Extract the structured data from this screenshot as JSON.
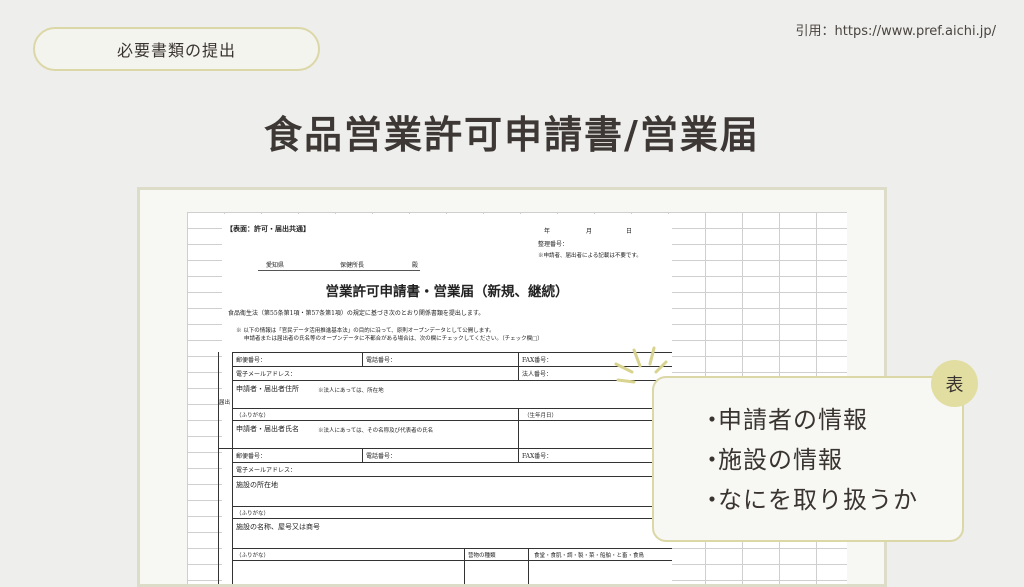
{
  "header": {
    "tag_label": "必要書類の提出",
    "source": "引用：https://www.pref.aichi.jp/"
  },
  "title": "食品営業許可申請書/営業届",
  "form": {
    "top_label": "【表面：許可・届出共通】",
    "date_year": "年",
    "date_month": "月",
    "date_day": "日",
    "ref_no": "整理番号：",
    "ref_note": "※申請者、届出者による記載は不要です。",
    "addressee_pref": "愛知県",
    "addressee_office": "保健所長",
    "addressee_honorific": "殿",
    "title": "営業許可申請書・営業届（新規、継続）",
    "intro": "食品衛生法（第55条第1項・第57条第1項）の規定に基づき次のとおり関係書類を提出します。",
    "note_line1": "※ 以下の情報は「官民データ活用推進基本法」の目的に沿って、原則オープンデータとして公開します。",
    "note_line2": "申請者または届出者の氏名等のオープンデータに不都合がある場合は、次の欄にチェックしてください。（チェック欄□）",
    "postal": "郵便番号：",
    "phone": "電話番号：",
    "fax": "FAX番号：",
    "email": "電子メールアドレス：",
    "corp_no": "法人番号：",
    "applicant_address": "申請者・届出者住所",
    "applicant_address_note": "※法人にあっては、所在地",
    "furigana": "（ふりがな）",
    "birthdate": "（生年月日）",
    "applicant_name": "申請者・届出者氏名",
    "applicant_name_note": "※法人にあっては、その名称及び代表者の氏名",
    "side_label": "届出",
    "postal2": "郵便番号：",
    "phone2": "電話番号：",
    "fax2": "FAX番号：",
    "email2": "電子メールアドレス：",
    "facility_address": "施設の所在地",
    "furigana2": "（ふりがな）",
    "facility_name": "施設の名称、屋号又は商号",
    "furigana3": "（ふりがな）",
    "business_type": "营物の種類",
    "categories": "食堂・食肌・調・製・菜・船舶・と畜・食鳥"
  },
  "callout": {
    "badge": "表",
    "items": [
      "申請者の情報",
      "施設の情報",
      "なにを取り扱うか"
    ]
  }
}
